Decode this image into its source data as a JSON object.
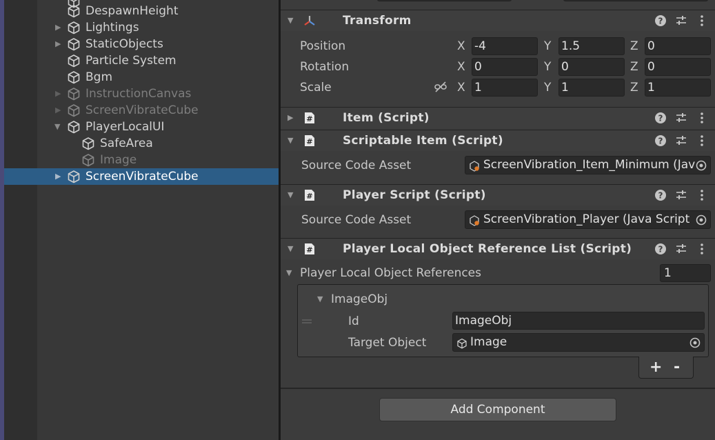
{
  "hierarchy": {
    "items": [
      {
        "label": "DespawnHeight",
        "has_arrow": false,
        "dim": false,
        "selected": false
      },
      {
        "label": "Lightings",
        "has_arrow": true,
        "dim": false,
        "selected": false
      },
      {
        "label": "StaticObjects",
        "has_arrow": true,
        "dim": false,
        "selected": false
      },
      {
        "label": "Particle System",
        "has_arrow": false,
        "dim": false,
        "selected": false
      },
      {
        "label": "Bgm",
        "has_arrow": false,
        "dim": false,
        "selected": false
      },
      {
        "label": "InstructionCanvas",
        "has_arrow": true,
        "dim": true,
        "selected": false
      },
      {
        "label": "ScreenVibrateCube",
        "has_arrow": true,
        "dim": true,
        "selected": false
      },
      {
        "label": "PlayerLocalUI",
        "has_arrow": true,
        "expanded": true,
        "dim": false,
        "selected": false
      },
      {
        "label": "SafeArea",
        "has_arrow": false,
        "dim": false,
        "selected": false,
        "child": true
      },
      {
        "label": "Image",
        "has_arrow": false,
        "dim": true,
        "selected": false,
        "child": true
      },
      {
        "label": "ScreenVibrateCube",
        "has_arrow": true,
        "dim": false,
        "selected": true
      }
    ]
  },
  "inspector": {
    "transform": {
      "title": "Transform",
      "position": {
        "label": "Position",
        "x": "-4",
        "y": "1.5",
        "z": "0"
      },
      "rotation": {
        "label": "Rotation",
        "x": "0",
        "y": "0",
        "z": "0"
      },
      "scale": {
        "label": "Scale",
        "x": "1",
        "y": "1",
        "z": "1"
      },
      "axis_x": "X",
      "axis_y": "Y",
      "axis_z": "Z"
    },
    "item_script": {
      "title": "Item (Script)"
    },
    "scriptable_item": {
      "title": "Scriptable Item (Script)",
      "source_label": "Source Code Asset",
      "source_value": "ScreenVibration_Item_Minimum (Java"
    },
    "player_script": {
      "title": "Player Script (Script)",
      "source_label": "Source Code Asset",
      "source_value": "ScreenVibration_Player (Java Script"
    },
    "player_local_refs": {
      "title": "Player Local Object Reference List (Script)",
      "list_label": "Player Local Object References",
      "count": "1",
      "element_title": "ImageObj",
      "id_label": "Id",
      "id_value": "ImageObj",
      "target_label": "Target Object",
      "target_value": "Image",
      "add": "+",
      "remove": "-"
    },
    "add_component": "Add Component"
  },
  "colors": {
    "selection": "#2c5d87",
    "panel": "#383838",
    "inspector": "#3c3c3c",
    "field": "#2a2a2a"
  }
}
